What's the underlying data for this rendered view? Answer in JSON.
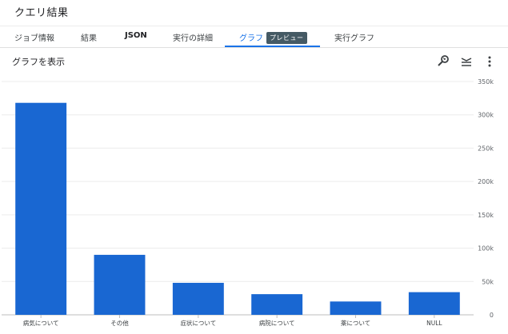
{
  "header": {
    "title": "クエリ結果"
  },
  "tabs": [
    {
      "label": "ジョブ情報"
    },
    {
      "label": "結果"
    },
    {
      "label": "JSON"
    },
    {
      "label": "実行の詳細"
    },
    {
      "label": "グラフ",
      "badge": "プレビュー"
    },
    {
      "label": "実行グラフ"
    }
  ],
  "chart_panel": {
    "heading": "グラフを表示",
    "icons": [
      "explore-icon",
      "series-settings-icon",
      "more-vert-icon"
    ]
  },
  "colors": {
    "bar": "#1967d2",
    "accent": "#1a73e8",
    "badge": "#455a64"
  },
  "chart_data": {
    "type": "bar",
    "categories": [
      "病気について",
      "その他",
      "症状について",
      "病院について",
      "薬について",
      "NULL"
    ],
    "values": [
      318000,
      90000,
      48000,
      31000,
      20000,
      34000
    ],
    "ylim": [
      0,
      350000
    ],
    "y_ticks": [
      {
        "value": 0,
        "label": "0"
      },
      {
        "value": 50000,
        "label": "50k"
      },
      {
        "value": 100000,
        "label": "100k"
      },
      {
        "value": 150000,
        "label": "150k"
      },
      {
        "value": 200000,
        "label": "200k"
      },
      {
        "value": 250000,
        "label": "250k"
      },
      {
        "value": 300000,
        "label": "300k"
      },
      {
        "value": 350000,
        "label": "350k"
      }
    ],
    "grid": true,
    "y_axis_position": "right"
  }
}
